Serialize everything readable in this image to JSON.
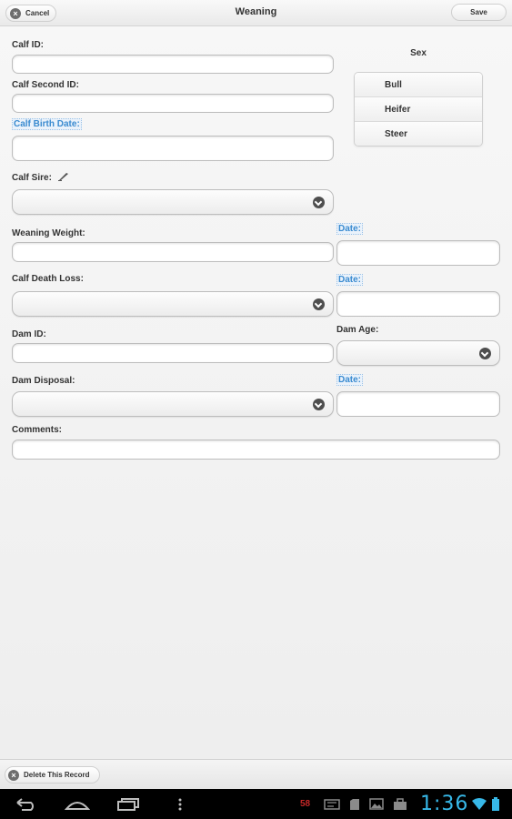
{
  "header": {
    "title": "Weaning",
    "cancel_label": "Cancel",
    "save_label": "Save"
  },
  "form": {
    "calf_id_label": "Calf ID:",
    "calf_second_id_label": "Calf Second ID:",
    "calf_birth_date_label": "Calf Birth Date:",
    "calf_sire_label": "Calf Sire:",
    "weaning_weight_label": "Weaning Weight:",
    "weaning_date_label": "Date:",
    "calf_death_loss_label": "Calf Death Loss:",
    "death_loss_date_label": "Date:",
    "dam_id_label": "Dam ID:",
    "dam_age_label": "Dam Age:",
    "dam_disposal_label": "Dam Disposal:",
    "disposal_date_label": "Date:",
    "comments_label": "Comments:"
  },
  "sex": {
    "title": "Sex",
    "options": [
      "Bull",
      "Heifer",
      "Steer"
    ]
  },
  "footer": {
    "delete_label": "Delete This Record"
  },
  "system_bar": {
    "time": "1:36",
    "battery_badge": "58"
  }
}
